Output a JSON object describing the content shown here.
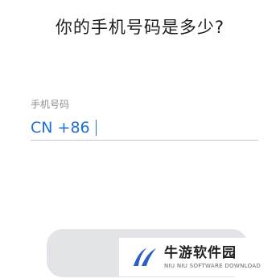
{
  "screen": {
    "question": "你的手机号码是多少?"
  },
  "phone_field": {
    "label": "手机号码",
    "country_code": "CN +86",
    "value": "",
    "accent_color": "#1f6fd6"
  },
  "primary_button": {
    "label": "",
    "color": "#e3e4e7"
  },
  "watermark": {
    "brand": "牛游软件园",
    "subtitle": "NIU NIU SOFTWARE DOWNLOAD",
    "logo_icon": "swoosh-logo-icon",
    "logo_color": "#2b5fc7"
  }
}
